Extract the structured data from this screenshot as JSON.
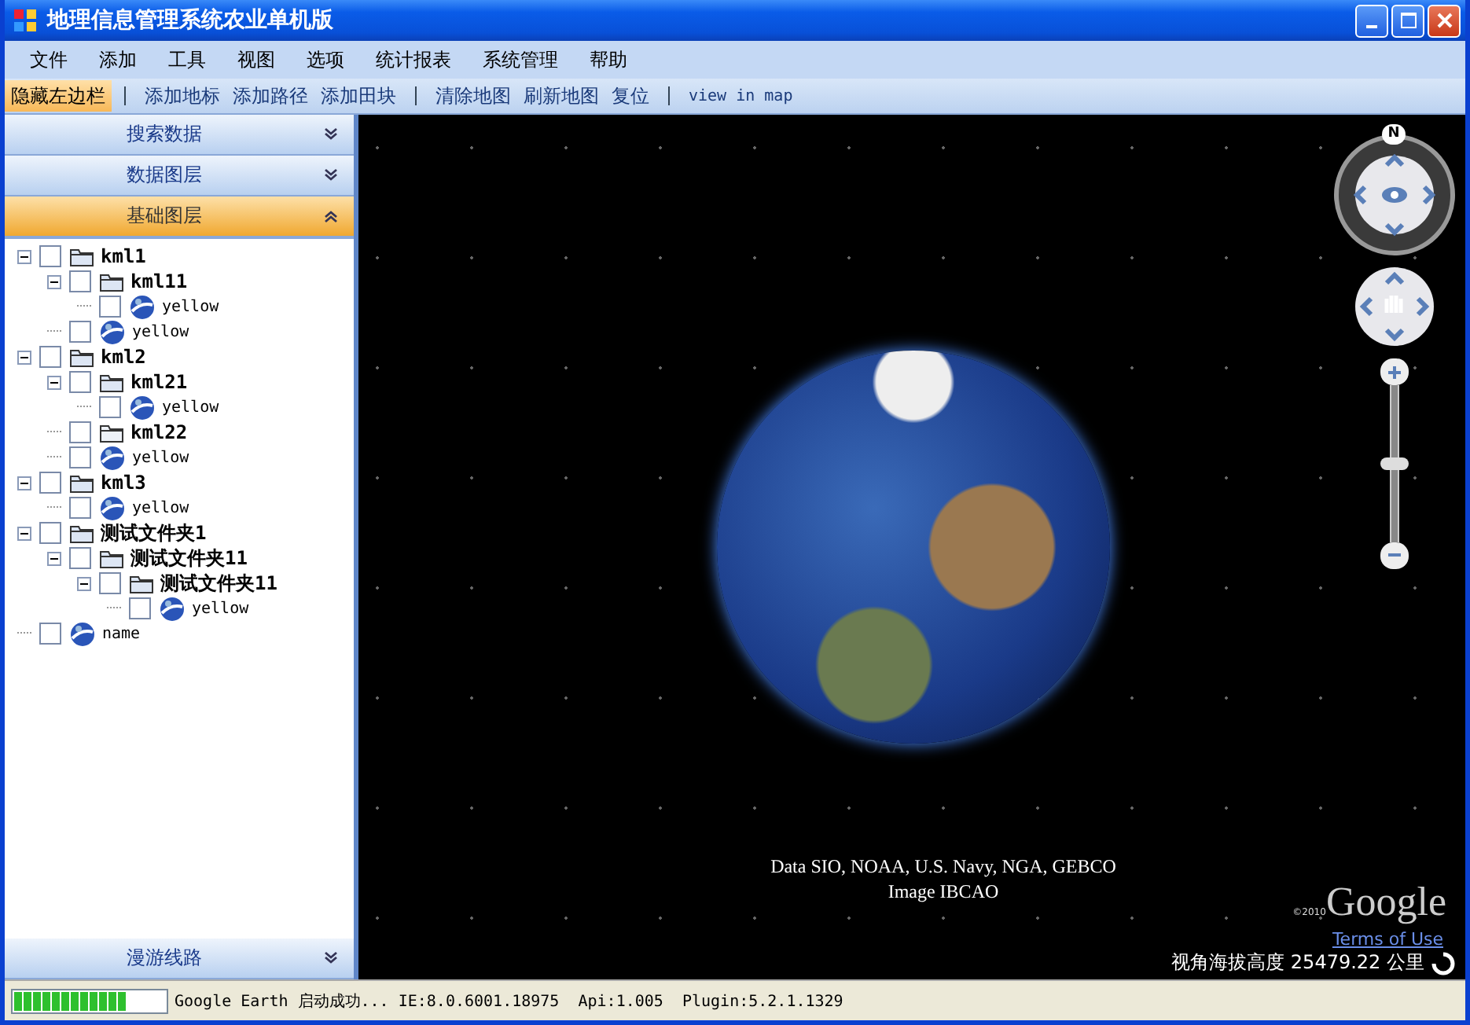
{
  "window": {
    "title": "地理信息管理系统农业单机版"
  },
  "menu": [
    "文件",
    "添加",
    "工具",
    "视图",
    "选项",
    "统计报表",
    "系统管理",
    "帮助"
  ],
  "toolbar": [
    {
      "kind": "button",
      "label": "隐藏左边栏",
      "selected": true
    },
    {
      "kind": "separator"
    },
    {
      "kind": "button",
      "label": "添加地标",
      "selected": false
    },
    {
      "kind": "button",
      "label": "添加路径",
      "selected": false
    },
    {
      "kind": "button",
      "label": "添加田块",
      "selected": false
    },
    {
      "kind": "separator"
    },
    {
      "kind": "button",
      "label": "清除地图",
      "selected": false
    },
    {
      "kind": "button",
      "label": "刷新地图",
      "selected": false
    },
    {
      "kind": "button",
      "label": "复位",
      "selected": false
    },
    {
      "kind": "separator"
    },
    {
      "kind": "mono",
      "label": "view in map",
      "selected": false
    }
  ],
  "sidebar": {
    "panels": [
      {
        "title": "搜索数据",
        "expanded": false
      },
      {
        "title": "数据图层",
        "expanded": false
      },
      {
        "title": "基础图层",
        "expanded": true
      }
    ],
    "bottom_panel": {
      "title": "漫游线路",
      "expanded": false
    }
  },
  "tree": [
    {
      "kind": "folder",
      "label": "kml1",
      "checked": false,
      "expanded": true,
      "children": [
        {
          "kind": "folder",
          "label": "kml11",
          "checked": false,
          "expanded": true,
          "children": [
            {
              "kind": "placemark",
              "label": "yellow",
              "checked": false
            }
          ]
        },
        {
          "kind": "placemark",
          "label": "yellow",
          "checked": false
        }
      ]
    },
    {
      "kind": "folder",
      "label": "kml2",
      "checked": false,
      "expanded": true,
      "children": [
        {
          "kind": "folder",
          "label": "kml21",
          "checked": false,
          "expanded": true,
          "children": [
            {
              "kind": "placemark",
              "label": "yellow",
              "checked": false
            }
          ]
        },
        {
          "kind": "folder",
          "label": "kml22",
          "checked": false
        },
        {
          "kind": "placemark",
          "label": "yellow",
          "checked": false
        }
      ]
    },
    {
      "kind": "folder",
      "label": "kml3",
      "checked": false,
      "expanded": true,
      "children": [
        {
          "kind": "placemark",
          "label": "yellow",
          "checked": false
        }
      ]
    },
    {
      "kind": "folder",
      "label": "测试文件夹1",
      "checked": false,
      "expanded": true,
      "children": [
        {
          "kind": "folder",
          "label": "测试文件夹11",
          "checked": false,
          "expanded": true,
          "children": [
            {
              "kind": "folder",
              "label": "测试文件夹11",
              "checked": false,
              "expanded": true,
              "children": [
                {
                  "kind": "placemark",
                  "label": "yellow",
                  "checked": false
                }
              ]
            }
          ]
        }
      ]
    },
    {
      "kind": "placemark",
      "label": "name",
      "checked": false
    }
  ],
  "map": {
    "compass": "N",
    "zoom": {
      "level": 0.5
    },
    "attribution": [
      "Data SIO, NOAA, U.S. Navy, NGA, GEBCO",
      "Image IBCAO"
    ],
    "copyright": "©2010",
    "logo": "Google",
    "terms_link": "Terms of Use",
    "altitude": "视角海拔高度 25479.22 公里"
  },
  "status_bar": {
    "progress": {
      "level": 0.75
    },
    "message": "Google Earth 启动成功... IE:8.0.6001.18975  Api:1.005  Plugin:5.2.1.1329"
  }
}
